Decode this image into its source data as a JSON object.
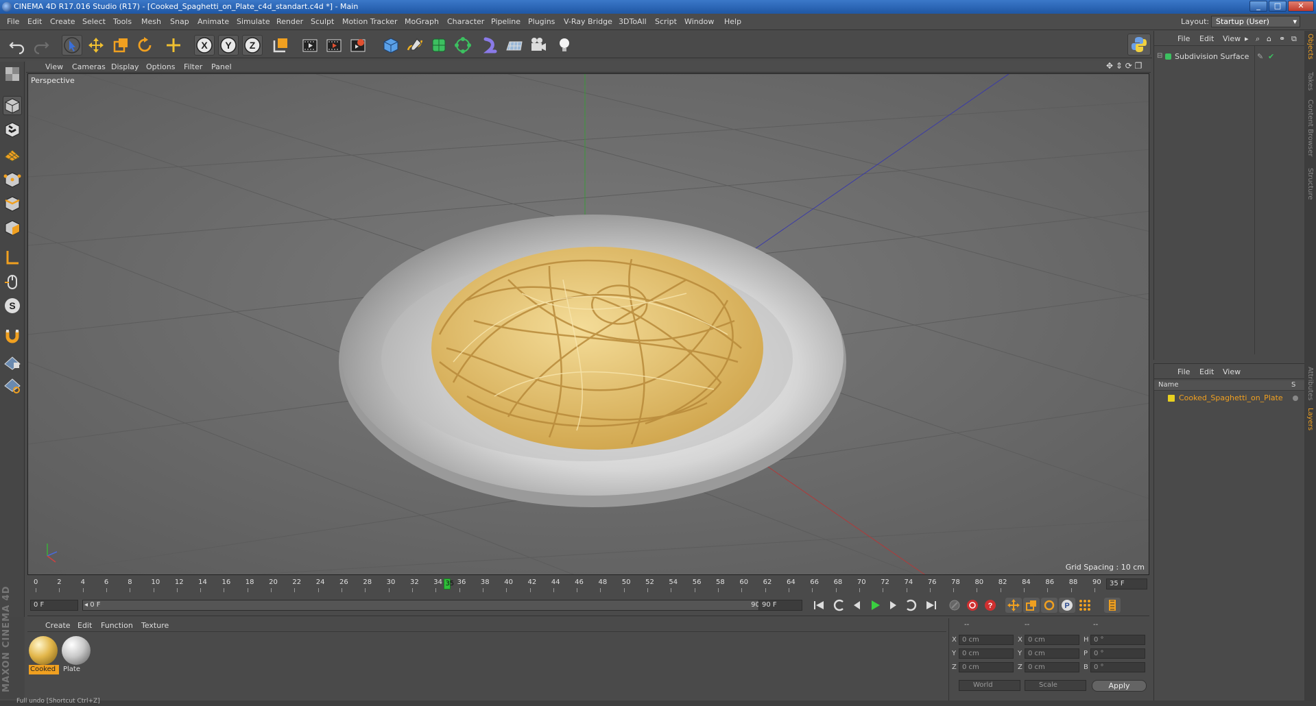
{
  "window": {
    "title": "CINEMA 4D R17.016 Studio (R17) - [Cooked_Spaghetti_on_Plate_c4d_standart.c4d *] - Main",
    "controls": [
      "_",
      "□",
      "✕"
    ]
  },
  "menubar": {
    "items": [
      "File",
      "Edit",
      "Create",
      "Select",
      "Tools",
      "Mesh",
      "Snap",
      "Animate",
      "Simulate",
      "Render",
      "Sculpt",
      "Motion Tracker",
      "MoGraph",
      "Character",
      "Pipeline",
      "Plugins",
      "V-Ray Bridge",
      "3DToAll",
      "Script",
      "Window",
      "Help"
    ],
    "layout_label": "Layout:",
    "layout_value": "Startup (User)"
  },
  "toolbar": {
    "icons": [
      "undo-icon",
      "redo-icon",
      "select-arrow-icon",
      "move-icon",
      "scale-icon",
      "rotate-icon",
      "add-object-icon",
      "x-axis-icon",
      "y-axis-icon",
      "z-axis-icon",
      "coordinate-system-icon",
      "render-view-icon",
      "render-picture-viewer-icon",
      "edit-render-settings-icon",
      "cube-icon",
      "pen-spline-icon",
      "subdivision-icon",
      "array-icon",
      "deformer-icon",
      "floor-icon",
      "camera-icon",
      "light-icon",
      "python-icon"
    ],
    "axis_labels": [
      "X",
      "Y",
      "Z"
    ]
  },
  "viewport": {
    "menu": [
      "View",
      "Cameras",
      "Display",
      "Options",
      "Filter",
      "Panel"
    ],
    "label": "Perspective",
    "grid_spacing": "Grid Spacing : 10 cm",
    "colors": {
      "background": "#6b6b6b",
      "plate": "#d8d8d8",
      "spaghetti": "#e8c878"
    }
  },
  "timeline": {
    "ticks": [
      "0",
      "2",
      "4",
      "6",
      "8",
      "10",
      "12",
      "14",
      "16",
      "18",
      "20",
      "22",
      "24",
      "26",
      "28",
      "30",
      "32",
      "34",
      "36",
      "38",
      "40",
      "42",
      "44",
      "46",
      "48",
      "50",
      "52",
      "54",
      "56",
      "58",
      "60",
      "62",
      "64",
      "66",
      "68",
      "70",
      "72",
      "74",
      "76",
      "78",
      "80",
      "82",
      "84",
      "86",
      "88",
      "90"
    ],
    "playhead_label": "35",
    "current_frame": 35,
    "max_frame": 90,
    "frame_box": "35 F"
  },
  "transport": {
    "start_field": "0 F",
    "range_start": "◂ 0 F",
    "range_end": "90 F ▸",
    "end_field": "90 F"
  },
  "materials": {
    "menu": [
      "Create",
      "Edit",
      "Function",
      "Texture"
    ],
    "items": [
      {
        "name": "Cooked",
        "color": "#e2b64a",
        "selected": true
      },
      {
        "name": "Plate",
        "color": "#c8c8c8",
        "selected": false
      }
    ]
  },
  "coordinates": {
    "header": [
      "--",
      "--",
      "--"
    ],
    "rows": [
      {
        "l1": "X",
        "v1": "0 cm",
        "l2": "X",
        "v2": "0 cm",
        "l3": "H",
        "v3": "0 °"
      },
      {
        "l1": "Y",
        "v1": "0 cm",
        "l2": "Y",
        "v2": "0 cm",
        "l3": "P",
        "v3": "0 °"
      },
      {
        "l1": "Z",
        "v1": "0 cm",
        "l2": "Z",
        "v2": "0 cm",
        "l3": "B",
        "v3": "0 °"
      }
    ],
    "mode": "World",
    "scale_mode": "Scale",
    "apply_label": "Apply"
  },
  "objects_panel": {
    "menu": [
      "File",
      "Edit",
      "View"
    ],
    "items": [
      {
        "name": "Subdivision Surface"
      }
    ]
  },
  "layers_panel": {
    "menu": [
      "File",
      "Edit",
      "View"
    ],
    "column_name": "Name",
    "column_s": "S",
    "items": [
      {
        "name": "Cooked_Spaghetti_on_Plate",
        "color": "#e8d020"
      }
    ]
  },
  "side_tabs": [
    "Objects",
    "Takes",
    "Content Browser",
    "Structure",
    "Attributes",
    "Layers"
  ],
  "logo": "MAXON CINEMA 4D",
  "status": "Full undo [Shortcut Ctrl+Z]"
}
